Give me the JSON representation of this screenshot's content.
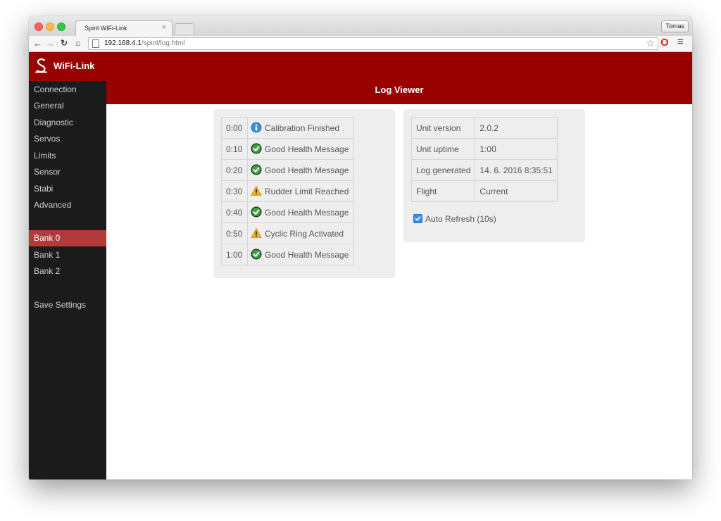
{
  "browser": {
    "tab_title": "Spirit WiFi-Link",
    "tab_close": "×",
    "profile": "Tomas",
    "url_host": "192.168.4.1",
    "url_path": "/spirit/log.html",
    "icons": {
      "back": "arrow-left-icon",
      "forward": "arrow-right-icon",
      "reload": "reload-icon",
      "home": "home-icon",
      "page": "page-icon",
      "star": "star-icon",
      "opera": "opera-icon",
      "menu": "hamburger-menu-icon"
    }
  },
  "app": {
    "brand": "WiFi-Link",
    "accent_color": "#990000",
    "active_color": "#b43a3a",
    "sidebar_color": "#1b1b1b"
  },
  "sidebar": {
    "items": [
      {
        "label": "Connection"
      },
      {
        "label": "General"
      },
      {
        "label": "Diagnostic"
      },
      {
        "label": "Servos"
      },
      {
        "label": "Limits"
      },
      {
        "label": "Sensor"
      },
      {
        "label": "Stabi"
      },
      {
        "label": "Advanced"
      }
    ],
    "banks": [
      {
        "label": "Bank 0",
        "active": true
      },
      {
        "label": "Bank 1"
      },
      {
        "label": "Bank 2"
      }
    ],
    "save": "Save Settings"
  },
  "header": {
    "title": "Log Viewer"
  },
  "log": {
    "rows": [
      {
        "time": "0:00",
        "icon": "info-icon",
        "message": "Calibration Finished"
      },
      {
        "time": "0:10",
        "icon": "check-circle-icon",
        "message": "Good Health Message"
      },
      {
        "time": "0:20",
        "icon": "check-circle-icon",
        "message": "Good Health Message"
      },
      {
        "time": "0:30",
        "icon": "warning-icon",
        "message": "Rudder Limit Reached"
      },
      {
        "time": "0:40",
        "icon": "check-circle-icon",
        "message": "Good Health Message"
      },
      {
        "time": "0:50",
        "icon": "warning-icon",
        "message": "Cyclic Ring Activated"
      },
      {
        "time": "1:00",
        "icon": "check-circle-icon",
        "message": "Good Health Message"
      }
    ]
  },
  "info": {
    "rows": [
      {
        "key": "Unit version",
        "value": "2.0.2"
      },
      {
        "key": "Unit uptime",
        "value": "1:00"
      },
      {
        "key": "Log generated",
        "value": "14. 6. 2016 8:35:51"
      },
      {
        "key": "Flight",
        "value": "Current"
      }
    ],
    "auto_refresh": {
      "label": "Auto Refresh (10s)",
      "checked": true
    }
  }
}
